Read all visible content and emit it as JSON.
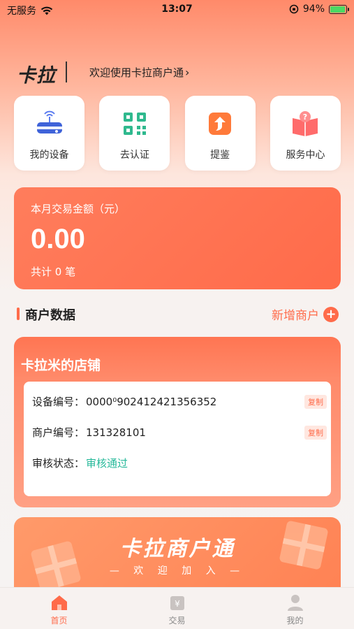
{
  "status_bar": {
    "carrier": "无服务",
    "time": "13:07",
    "battery": "94%",
    "battery_level": 0.94
  },
  "header": {
    "brand": "卡拉",
    "welcome": "欢迎使用卡拉商户通"
  },
  "tiles": [
    {
      "label": "我的设备",
      "icon": "device-icon"
    },
    {
      "label": "去认证",
      "icon": "qr-code-icon"
    },
    {
      "label": "提鉴",
      "icon": "withdraw-icon"
    },
    {
      "label": "服务中心",
      "icon": "service-book-icon"
    }
  ],
  "transaction": {
    "title": "本月交易金额（元）",
    "amount": "0.00",
    "count": "共计 0 笔"
  },
  "section": {
    "title": "商户数据",
    "add_label": "新增商户"
  },
  "merchant": {
    "store_name": "卡拉米的店铺",
    "rows": [
      {
        "key": "设备编号：",
        "value": "0000⁰9024​12421356352",
        "copy": "复制"
      },
      {
        "key": "商户编号：",
        "value": "131328101",
        "copy": "复制"
      },
      {
        "key": "审核状态：",
        "value": "审核通过"
      }
    ]
  },
  "banner": {
    "title": "卡拉商户通",
    "subtitle": "— 欢 迎 加 入 —"
  },
  "tabbar": [
    {
      "label": "首页",
      "icon": "home-icon",
      "active": true
    },
    {
      "label": "交易",
      "icon": "transaction-icon",
      "active": false
    },
    {
      "label": "我的",
      "icon": "profile-icon",
      "active": false
    }
  ],
  "colors": {
    "accent": "#ff6b4a",
    "success": "#27b99a"
  }
}
